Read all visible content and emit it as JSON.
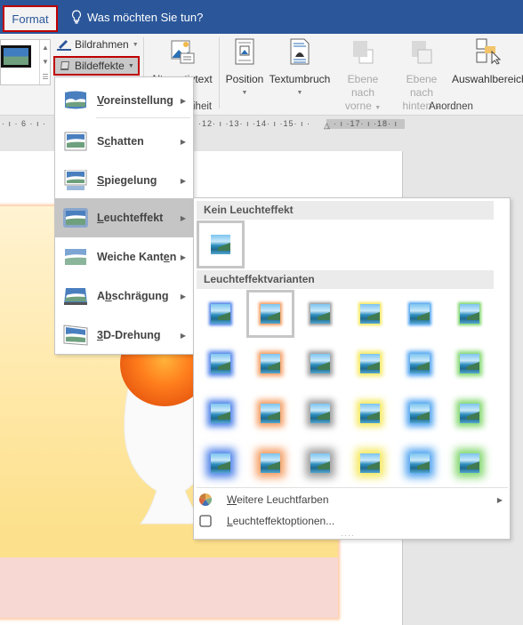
{
  "titlebar": {
    "active_tab": "Format",
    "tell_me": "Was möchten Sie tun?"
  },
  "ribbon": {
    "bildrahmen": "Bildrahmen",
    "bildeffekte": "Bildeffekte",
    "alternativtext": "Alternativtext",
    "barrierefreiheit_fragment": "iheit",
    "position": "Position",
    "textumbruch": "Textumbruch",
    "ebene_vorne_line1": "Ebene nach",
    "ebene_vorne_line2": "vorne",
    "ebene_hinten_line1": "Ebene nach",
    "ebene_hinten_line2": "hinten",
    "auswahlbereich": "Auswahlbereich",
    "group_anordnen": "Anordnen"
  },
  "ruler": {
    "left_ticks": "· ı · 6 · ı ·",
    "right_ticks": "·12· ı ·13· ı ·14· ı ·15· ı ·",
    "shaded_ticks": "· ı ·17· ı ·18· ı"
  },
  "effects_menu": {
    "items": [
      {
        "label_u": "V",
        "label_rest": "oreinstellung",
        "icon": "preset-icon"
      },
      {
        "label_pre": "S",
        "label_u": "c",
        "label_rest": "hatten",
        "icon": "shadow-icon"
      },
      {
        "label_u": "S",
        "label_rest": "piegelung",
        "icon": "reflection-icon"
      },
      {
        "label_u": "L",
        "label_rest": "euchteffekt",
        "icon": "glow-icon",
        "active": true
      },
      {
        "label_pre": "Weiche Kant",
        "label_u": "e",
        "label_rest": "n",
        "icon": "soft-edges-icon"
      },
      {
        "label_pre": "A",
        "label_u": "b",
        "label_rest": "schrägung",
        "icon": "bevel-icon"
      },
      {
        "label_u": "3",
        "label_rest": "D-Drehung",
        "icon": "3d-rotation-icon"
      }
    ]
  },
  "glow_menu": {
    "no_glow_header": "Kein Leuchteffekt",
    "variants_header": "Leuchteffektvarianten",
    "glow_colors": [
      "#4a7fe8",
      "#f59a5c",
      "#9a9a9a",
      "#f5e85a",
      "#4aa0f0",
      "#7fd66a"
    ],
    "rows": 4,
    "selected": {
      "row": 0,
      "col": 1
    },
    "more_colors": {
      "u": "W",
      "rest": "eitere Leuchtfarben"
    },
    "options": {
      "u": "L",
      "rest": "euchteffektoptionen..."
    }
  }
}
